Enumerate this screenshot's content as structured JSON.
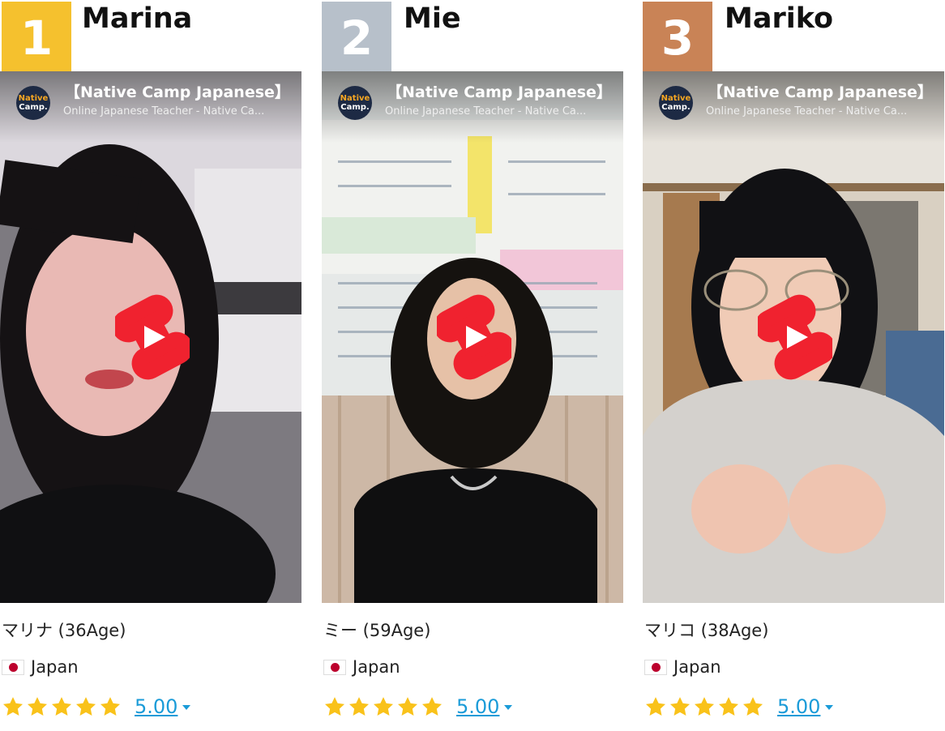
{
  "colors": {
    "rank_gold": "#f5c12e",
    "rank_silver": "#b7c0ca",
    "rank_bronze": "#c98356",
    "star": "#f9c21a",
    "link": "#1a9bd8",
    "play_red": "#f0222f"
  },
  "icons": {
    "play": "youtube-shorts-play-icon",
    "star": "star-icon",
    "flag": "japan-flag-icon",
    "dropdown": "chevron-down-icon"
  },
  "teachers": [
    {
      "rank": "1",
      "name": "Marina",
      "video_title": "【Native Camp Japanese】",
      "video_subtitle": "Online Japanese Teacher - Native Ca...",
      "channel_logo_line1": "Native",
      "channel_logo_line2": "Camp.",
      "jp_name_age": "マリナ (36Age)",
      "country": "Japan",
      "stars": 5,
      "rating": "5.00"
    },
    {
      "rank": "2",
      "name": "Mie",
      "video_title": "【Native Camp Japanese】",
      "video_subtitle": "Online Japanese Teacher - Native Ca...",
      "channel_logo_line1": "Native",
      "channel_logo_line2": "Camp.",
      "jp_name_age": "ミー (59Age)",
      "country": "Japan",
      "stars": 5,
      "rating": "5.00"
    },
    {
      "rank": "3",
      "name": "Mariko",
      "video_title": "【Native Camp Japanese】",
      "video_subtitle": "Online Japanese Teacher - Native Ca...",
      "channel_logo_line1": "Native",
      "channel_logo_line2": "Camp.",
      "jp_name_age": "マリコ (38Age)",
      "country": "Japan",
      "stars": 5,
      "rating": "5.00"
    }
  ]
}
